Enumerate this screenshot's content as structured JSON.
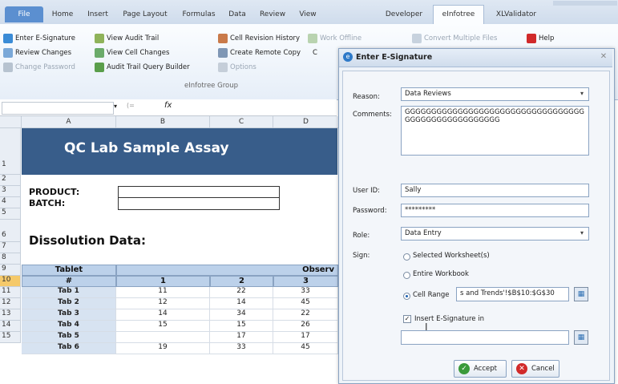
{
  "ribbon_tabs": [
    "File",
    "Home",
    "Insert",
    "Page Layout",
    "Formulas",
    "Data",
    "Review",
    "View",
    "Developer",
    "eInfotree",
    "XLValidator"
  ],
  "active_tab": "eInfotree",
  "ribbon": {
    "col1": [
      "Enter E-Signature",
      "Review Changes",
      "Change Password"
    ],
    "col2": [
      "View Audit Trail",
      "View Cell Changes",
      "Audit Trail Query Builder"
    ],
    "col3": [
      "Cell Revision History",
      "Create Remote Copy",
      "Options"
    ],
    "col4": [
      "Work Offline",
      "C"
    ],
    "col5": [
      "Convert Multiple Files",
      "Help"
    ],
    "group_label": "eInfotree Group"
  },
  "formula_bar": {
    "fx": "fx",
    "name_drop": "▾",
    "fn": "(="
  },
  "columns": [
    "A",
    "B",
    "C",
    "D"
  ],
  "rows": [
    "1",
    "2",
    "3",
    "4",
    "5",
    "6",
    "7",
    "8",
    "9",
    "10",
    "11",
    "12",
    "13",
    "14",
    "15"
  ],
  "sheet": {
    "title": "QC Lab Sample Assay",
    "product_label": "PRODUCT:",
    "batch_label": "BATCH:",
    "section": "Dissolution Data:",
    "table_header_tablet": "Tablet",
    "table_header_hash": "#",
    "table_header_obs": "Observ",
    "col_nums": [
      "1",
      "2",
      "3"
    ],
    "data_rows": [
      {
        "tab": "Tab 1",
        "v": [
          "11",
          "22",
          "33"
        ]
      },
      {
        "tab": "Tab 2",
        "v": [
          "12",
          "14",
          "45"
        ]
      },
      {
        "tab": "Tab 3",
        "v": [
          "14",
          "34",
          "22"
        ]
      },
      {
        "tab": "Tab 4",
        "v": [
          "15",
          "15",
          "26"
        ]
      },
      {
        "tab": "Tab 5",
        "v": [
          "",
          "17",
          "17"
        ]
      },
      {
        "tab": "Tab 6",
        "v": [
          "19",
          "33",
          "45"
        ]
      }
    ]
  },
  "dialog": {
    "title": "Enter E-Signature",
    "reason_label": "Reason:",
    "reason_value": "Data Reviews",
    "comments_label": "Comments:",
    "comments_value": "GGGGGGGGGGGGGGGGGGGGGGGGGGGGGGGGGGGGGGGGGGGGGGGGGGGG",
    "userid_label": "User ID:",
    "userid_value": "Sally",
    "password_label": "Password:",
    "password_value": "*********",
    "role_label": "Role:",
    "role_value": "Data Entry",
    "sign_label": "Sign:",
    "opt_selected": "Selected Worksheet(s)",
    "opt_workbook": "Entire Workbook",
    "opt_cellrange": "Cell Range",
    "cellrange_value": "s and Trends'!$B$10:$G$30",
    "insert_label": "Insert E-Signature in",
    "accept": "Accept",
    "cancel": "Cancel"
  }
}
